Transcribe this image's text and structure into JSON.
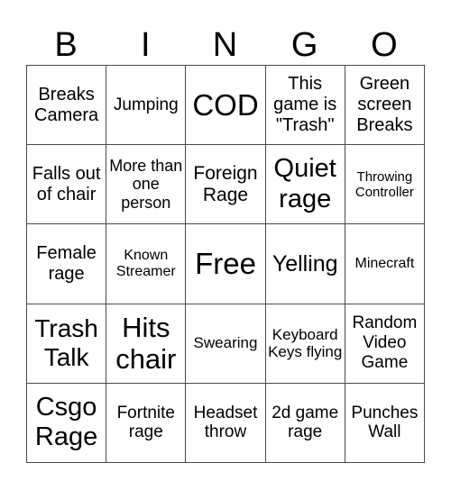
{
  "header": {
    "letters": [
      "B",
      "I",
      "N",
      "G",
      "O"
    ]
  },
  "card": {
    "rows": [
      [
        "Breaks Camera",
        "Jumping",
        "COD",
        "This game is \"Trash\"",
        "Green screen Breaks"
      ],
      [
        "Falls out of chair",
        "More than one person",
        "Foreign Rage",
        "Quiet rage",
        "Throwing Controller"
      ],
      [
        "Female rage",
        "Known Streamer",
        "Free",
        "Yelling",
        "Minecraft"
      ],
      [
        "Trash Talk",
        "Hits chair",
        "Swearing",
        "Keyboard Keys flying",
        "Random Video Game"
      ],
      [
        "Csgo Rage",
        "Fortnite rage",
        "Headset throw",
        "2d game rage",
        "Punches Wall"
      ]
    ]
  },
  "colors": {
    "grid_line": "#4a4a4a",
    "text": "#000000",
    "background": "#ffffff"
  }
}
